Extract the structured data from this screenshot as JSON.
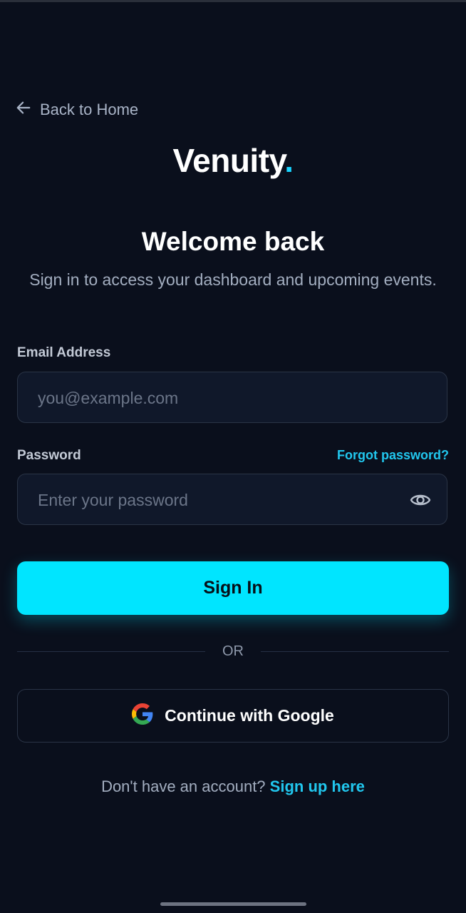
{
  "nav": {
    "back_label": "Back to Home"
  },
  "brand": {
    "name": "Venuity",
    "dot": ".",
    "accent_color": "#19d3ff"
  },
  "header": {
    "title": "Welcome back",
    "subtitle": "Sign in to access your dashboard and upcoming events."
  },
  "form": {
    "email": {
      "label": "Email Address",
      "placeholder": "you@example.com",
      "value": ""
    },
    "password": {
      "label": "Password",
      "placeholder": "Enter your password",
      "value": "",
      "forgot_label": "Forgot password?"
    },
    "submit_label": "Sign In"
  },
  "divider": {
    "label": "OR"
  },
  "oauth": {
    "google_label": "Continue with Google"
  },
  "footer": {
    "prompt": "Don't have an account?",
    "signup_label": "Sign up here"
  },
  "icons": {
    "back": "arrow-left-icon",
    "password_toggle": "eye-icon",
    "google": "google-icon"
  },
  "colors": {
    "background": "#0a0f1c",
    "primary": "#00e5ff",
    "link": "#21c7ee"
  }
}
